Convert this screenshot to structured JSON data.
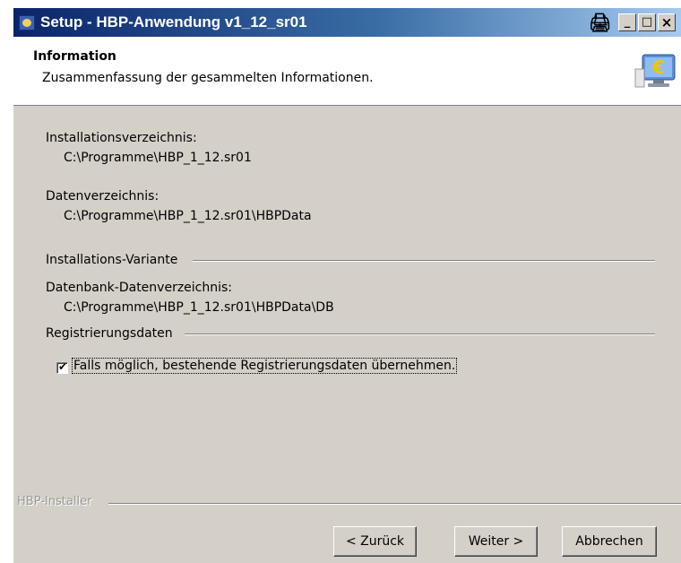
{
  "window": {
    "title": "Setup - HBP-Anwendung v1_12_sr01",
    "print_glyph": "🖨",
    "min_glyph": "_",
    "max_glyph": "□",
    "close_glyph": "×"
  },
  "header": {
    "title": "Information",
    "subtitle": "Zusammenfassung der gesammelten Informationen."
  },
  "summary": {
    "install_dir_label": "Installationsverzeichnis:",
    "install_dir_value": "C:\\Programme\\HBP_1_12.sr01",
    "data_dir_label": "Datenverzeichnis:",
    "data_dir_value": "C:\\Programme\\HBP_1_12.sr01\\HBPData",
    "variant_heading": "Installations-Variante",
    "db_dir_label": "Datenbank-Datenverzeichnis:",
    "db_dir_value": "C:\\Programme\\HBP_1_12.sr01\\HBPData\\DB",
    "registration_heading": "Registrierungsdaten",
    "registration_checkbox_label": "Falls möglich, bestehende Registrierungsdaten übernehmen.",
    "registration_checked": true
  },
  "footer": {
    "brand": "HBP-Installer",
    "back_label": "< Zurück",
    "next_label": "Weiter >",
    "cancel_label": "Abbrechen"
  },
  "icons": {
    "app": "app-icon",
    "logo": "euro-monitor-icon",
    "print": "print-icon"
  },
  "colors": {
    "title_gradient_start": "#0a246a",
    "title_gradient_end": "#a6caf0",
    "dialog_bg": "#d4d0c8"
  }
}
